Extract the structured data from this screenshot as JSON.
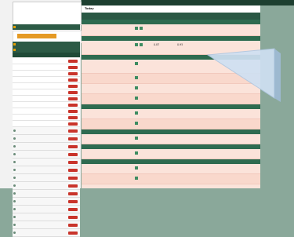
{
  "sidebar": {
    "account_lines": [
      "",
      "",
      ""
    ],
    "balance_left": "",
    "balance_right": "",
    "section1": "",
    "orange_button": "",
    "section2": "",
    "section3": "",
    "tabs": [
      "",
      "",
      ""
    ],
    "list_items": [
      "",
      "",
      "",
      "",
      "",
      "",
      "",
      "",
      "",
      "",
      ""
    ],
    "categories": [
      "",
      "",
      "",
      "",
      "",
      "",
      "",
      "",
      "",
      "",
      "",
      "",
      "",
      "",
      "",
      "",
      "",
      ""
    ]
  },
  "topbar": {
    "left_text": "",
    "mid_text": "",
    "right_items": [
      "",
      "",
      "",
      "",
      ""
    ]
  },
  "subbar": {
    "day": "Today",
    "tab": "",
    "right_text": ""
  },
  "columns": {
    "event": "",
    "full_time": "",
    "first_half": "",
    "sub1": [
      "",
      "",
      ""
    ],
    "sub2": [
      "",
      "",
      ""
    ]
  },
  "table": {
    "sections": [
      {
        "label": "",
        "rows": [
          {
            "time": "",
            "team1": "",
            "team2": "",
            "odds": [
              "",
              "",
              "",
              "",
              ""
            ]
          }
        ]
      },
      {
        "label": "",
        "rows": [
          {
            "time": "",
            "team1": "",
            "team2": "",
            "odds": [
              "0.87",
              "0.95",
              "",
              "",
              ""
            ]
          }
        ]
      },
      {
        "label": "",
        "rows": [
          {
            "time": "",
            "team1": "",
            "team2": "",
            "odds": [
              "",
              "",
              "",
              "",
              ""
            ]
          },
          {
            "time": "",
            "team1": "",
            "team2": "",
            "odds": [
              "",
              "",
              "",
              "",
              ""
            ]
          },
          {
            "time": "",
            "team1": "",
            "team2": "",
            "odds": [
              "",
              "",
              "",
              "",
              ""
            ]
          },
          {
            "time": "",
            "team1": "",
            "team2": "",
            "odds": [
              "",
              "",
              "",
              "",
              ""
            ]
          }
        ]
      },
      {
        "label": "",
        "rows": [
          {
            "time": "",
            "team1": "",
            "team2": "",
            "odds": [
              "",
              "",
              "",
              "",
              ""
            ]
          },
          {
            "time": "",
            "team1": "",
            "team2": "",
            "odds": [
              "",
              "",
              "",
              "",
              ""
            ]
          }
        ]
      },
      {
        "label": "",
        "rows": [
          {
            "time": "",
            "team1": "",
            "team2": "",
            "odds": [
              "",
              "",
              "",
              "",
              ""
            ]
          }
        ]
      },
      {
        "label": "",
        "rows": [
          {
            "time": "",
            "team1": "",
            "team2": "",
            "odds": [
              "",
              "",
              "",
              "",
              ""
            ]
          }
        ]
      },
      {
        "label": "",
        "rows": [
          {
            "time": "",
            "team1": "",
            "team2": "",
            "odds": [
              "",
              "",
              "",
              "",
              ""
            ]
          },
          {
            "time": "",
            "team1": "",
            "team2": "",
            "odds": [
              "",
              "",
              "",
              "",
              ""
            ]
          }
        ]
      }
    ]
  },
  "colors": {
    "header_green": "#2a5844",
    "section_green": "#2e6b50",
    "row_bg": "#fbe3da",
    "row_bg_alt": "#f9d8cc",
    "accent_orange": "#e59a25",
    "badge_red": "#c9342b",
    "cursor_blue": "#cfe0f2"
  }
}
